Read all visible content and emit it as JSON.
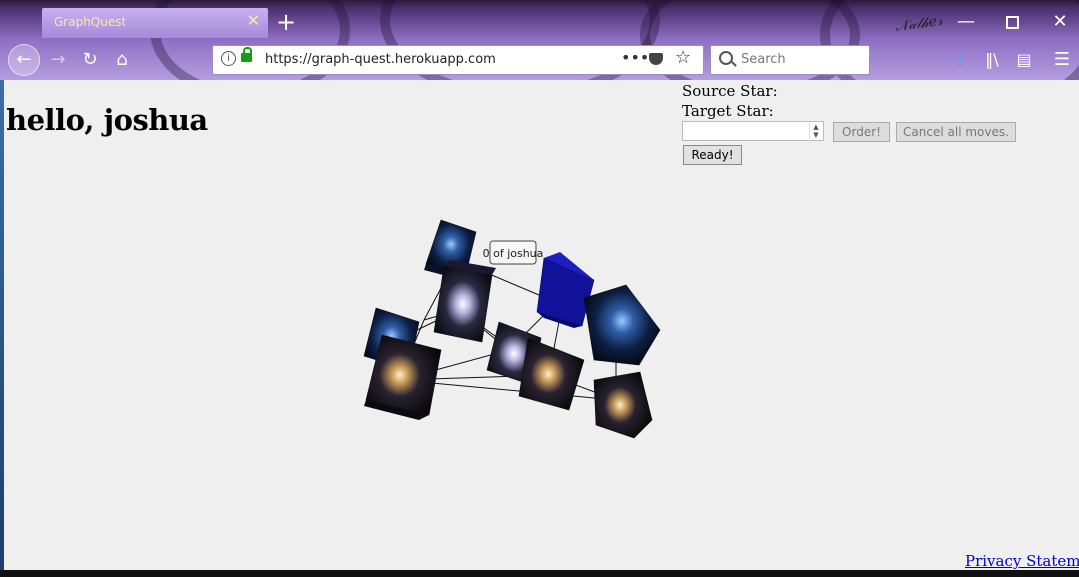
{
  "browser": {
    "tab_title": "GraphQuest",
    "tab_close": "✕",
    "new_tab": "+",
    "url": "https://graph-quest.herokuapp.com",
    "search_placeholder": "Search",
    "window_controls": [
      "minimize",
      "maximize",
      "close"
    ]
  },
  "page": {
    "greeting": "hello, joshua",
    "source_star_label": "Source Star:",
    "target_star_label": "Target Star:",
    "order_button": "Order!",
    "cancel_button": "Cancel all moves.",
    "ready_button": "Ready!",
    "privacy_link": "Privacy Statement"
  },
  "scene": {
    "star_label": "0 of joshua",
    "highlight_color": "#10129a"
  },
  "colors": {
    "chrome_accent": "#9d85d4",
    "page_background": "#efefef",
    "link": "#0000cc"
  }
}
